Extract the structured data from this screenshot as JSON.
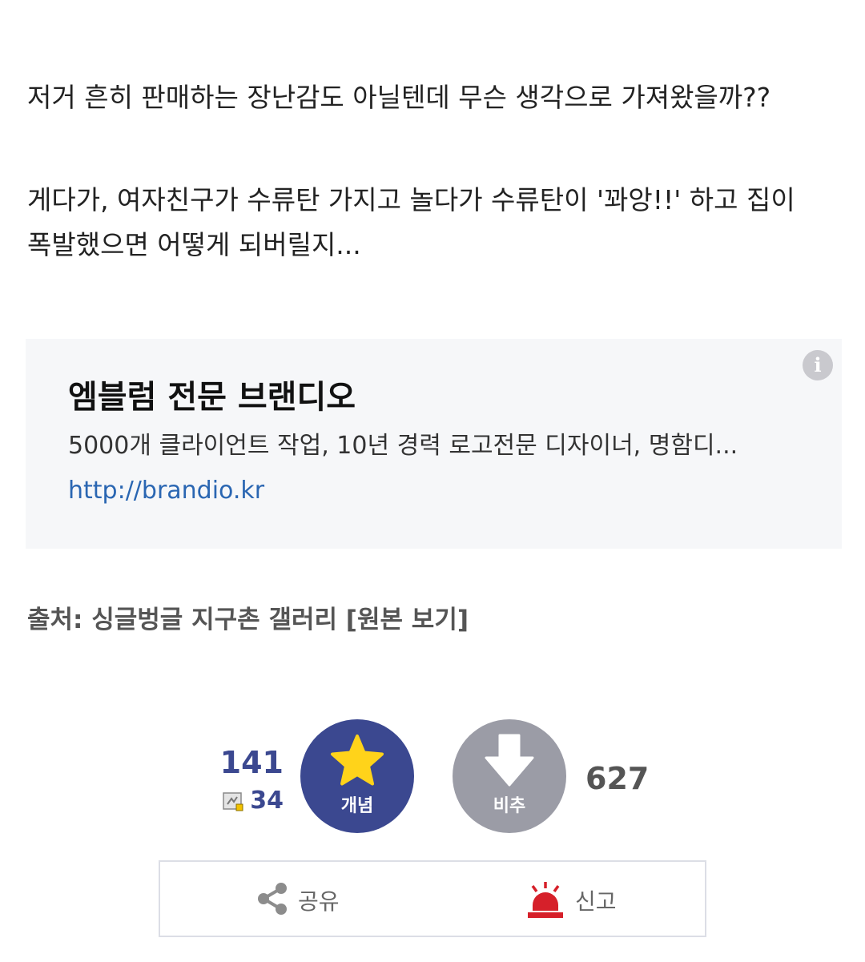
{
  "post": {
    "paragraphs": [
      "저거 흔히 판매하는 장난감도 아닐텐데 무슨 생각으로 가져왔을까??",
      "게다가, 여자친구가 수류탄 가지고 놀다가 수류탄이 '꽈앙!!' 하고 집이",
      "폭발했으면 어떻게 되버릴지..."
    ]
  },
  "ad": {
    "info_icon": "info-icon",
    "info_glyph": "i",
    "title": "엠블럼 전문 브랜디오",
    "description": "5000개 클라이언트 작업, 10년 경력 로고전문 디자이너, 명함디...",
    "url": "http://brandio.kr"
  },
  "source": {
    "text": "출처: 싱글벙글 지구촌 갤러리 [원본 보기]"
  },
  "votes": {
    "up_count": "141",
    "fixed_count": "34",
    "fixed_icon": "fixed-comment-icon",
    "up_label": "개념",
    "up_icon": "star-icon",
    "down_label": "비추",
    "down_icon": "down-arrow-icon",
    "down_count": "627",
    "up_color": "#3b4890",
    "down_color": "#9b9ca6",
    "star_color": "#ffd31a"
  },
  "actions": {
    "share_label": "공유",
    "share_icon": "share-icon",
    "report_label": "신고",
    "report_icon": "siren-icon",
    "report_color": "#d6202a"
  }
}
